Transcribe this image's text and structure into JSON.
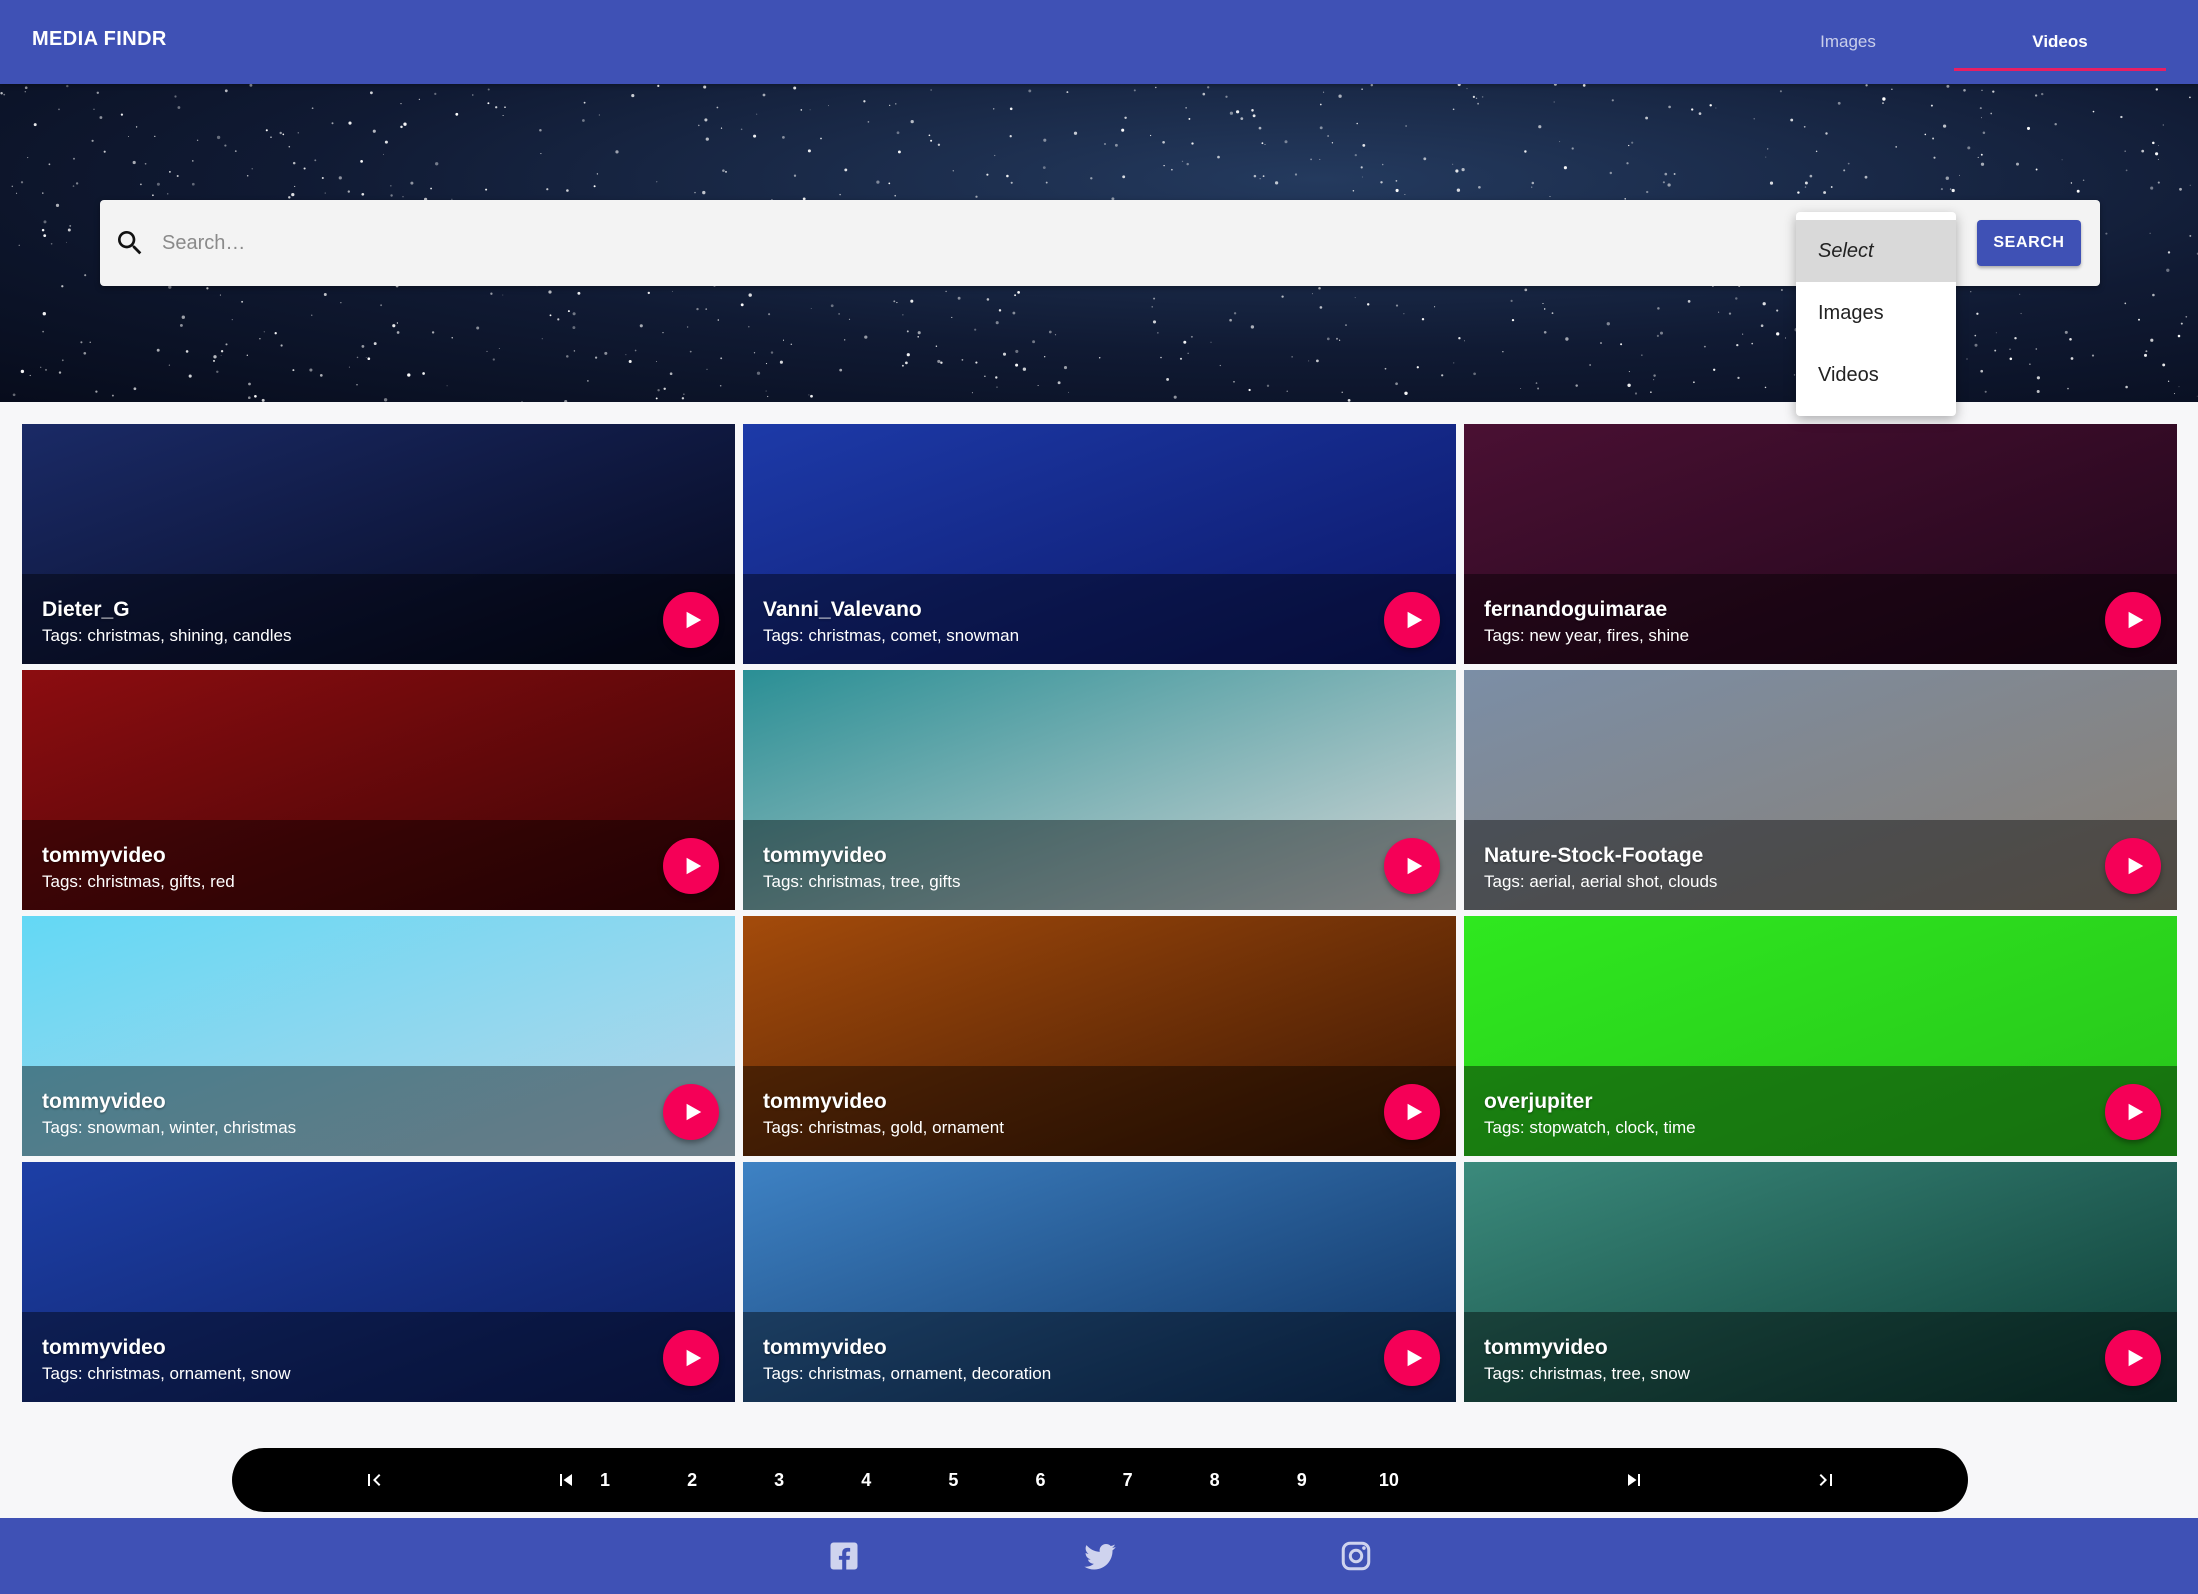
{
  "app": {
    "title": "MEDIA FINDR"
  },
  "nav": {
    "tabs": [
      {
        "label": "Images"
      },
      {
        "label": "Videos"
      }
    ],
    "active": "Videos"
  },
  "search": {
    "placeholder": "Search…",
    "value": "",
    "button_label": "SEARCH"
  },
  "media_type_select": {
    "options": [
      {
        "label": "Select"
      },
      {
        "label": "Images"
      },
      {
        "label": "Videos"
      }
    ],
    "highlighted": "Select"
  },
  "cards": [
    {
      "author": "Dieter_G",
      "tags": "Tags: christmas, shining, candles",
      "colors": [
        "#1a2a66",
        "#05081c"
      ]
    },
    {
      "author": "Vanni_Valevano",
      "tags": "Tags: christmas, comet, snowman",
      "colors": [
        "#1d3aa8",
        "#0b1666"
      ]
    },
    {
      "author": "fernandoguimarae",
      "tags": "Tags: new year, fires, shine",
      "colors": [
        "#4a1033",
        "#1f0619"
      ]
    },
    {
      "author": "tommyvideo",
      "tags": "Tags: christmas, gifts, red",
      "colors": [
        "#8c0d10",
        "#3b0405"
      ]
    },
    {
      "author": "tommyvideo",
      "tags": "Tags: christmas, tree, gifts",
      "colors": [
        "#2a8f95",
        "#d8d8d8"
      ]
    },
    {
      "author": "Nature-Stock-Footage",
      "tags": "Tags: aerial, aerial shot, clouds",
      "colors": [
        "#7b8ea6",
        "#8a7f72"
      ]
    },
    {
      "author": "tommyvideo",
      "tags": "Tags: snowman, winter, christmas",
      "colors": [
        "#63d8f5",
        "#b9d6e8"
      ]
    },
    {
      "author": "tommyvideo",
      "tags": "Tags: christmas, gold, ornament",
      "colors": [
        "#a44b0b",
        "#3a1603"
      ]
    },
    {
      "author": "overjupiter",
      "tags": "Tags: stopwatch, clock, time",
      "colors": [
        "#2fe81f",
        "#27c41a"
      ]
    },
    {
      "author": "tommyvideo",
      "tags": "Tags: christmas, ornament, snow",
      "colors": [
        "#1d3fa6",
        "#0c1d5c"
      ]
    },
    {
      "author": "tommyvideo",
      "tags": "Tags: christmas, ornament, decoration",
      "colors": [
        "#3e82c4",
        "#0d2f5e"
      ]
    },
    {
      "author": "tommyvideo",
      "tags": "Tags: christmas, tree, snow",
      "colors": [
        "#3b8a7c",
        "#0b3a33"
      ]
    }
  ],
  "pagination": {
    "pages": [
      "1",
      "2",
      "3",
      "4",
      "5",
      "6",
      "7",
      "8",
      "9",
      "10"
    ]
  },
  "footer": {
    "social": [
      "facebook-icon",
      "twitter-icon",
      "instagram-icon"
    ]
  },
  "theme": {
    "primary": "#3f51b5",
    "accent": "#f50057",
    "indicator": "#e91e63"
  }
}
